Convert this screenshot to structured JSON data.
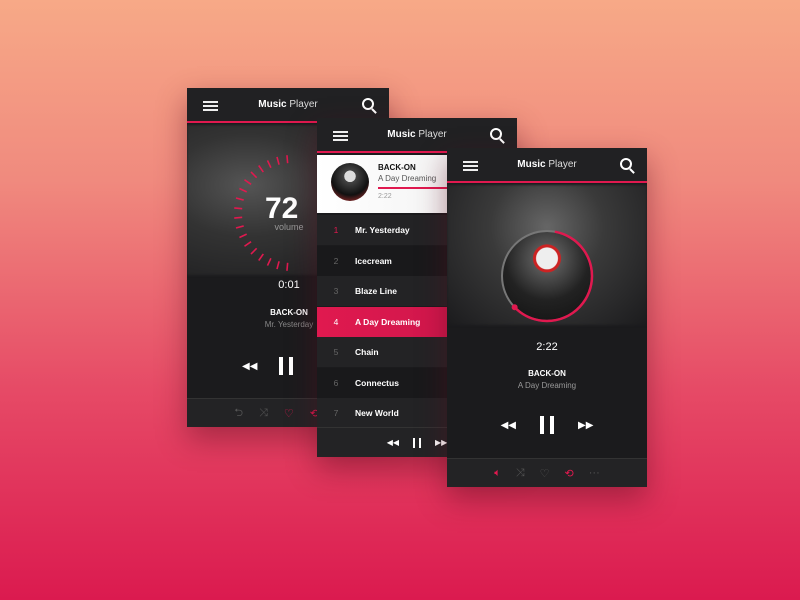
{
  "app_title": {
    "bold": "Music",
    "rest": "Player"
  },
  "colors": {
    "accent": "#e0194f",
    "panel": "#1b1b1d"
  },
  "volume_screen": {
    "volume": "72",
    "volume_label": "volume",
    "time": "0:01",
    "artist": "BACK-ON",
    "song": "Mr. Yesterday",
    "icons": [
      "repeat-icon",
      "shuffle-icon",
      "heart-icon",
      "repeat-active-icon"
    ]
  },
  "playlist_screen": {
    "now_playing": {
      "artist": "BACK-ON",
      "song": "A Day Dreaming",
      "time": "2:22",
      "progress": 0.5
    },
    "tracks": [
      {
        "num": "1",
        "title": "Mr. Yesterday"
      },
      {
        "num": "2",
        "title": "Icecream"
      },
      {
        "num": "3",
        "title": "Blaze Line"
      },
      {
        "num": "4",
        "title": "A Day Dreaming",
        "active": true
      },
      {
        "num": "5",
        "title": "Chain"
      },
      {
        "num": "6",
        "title": "Connectus"
      },
      {
        "num": "7",
        "title": "New World"
      }
    ]
  },
  "player_screen": {
    "time": "2:22",
    "artist": "BACK-ON",
    "song": "A Day Dreaming",
    "progress": 0.6,
    "more": "···"
  }
}
